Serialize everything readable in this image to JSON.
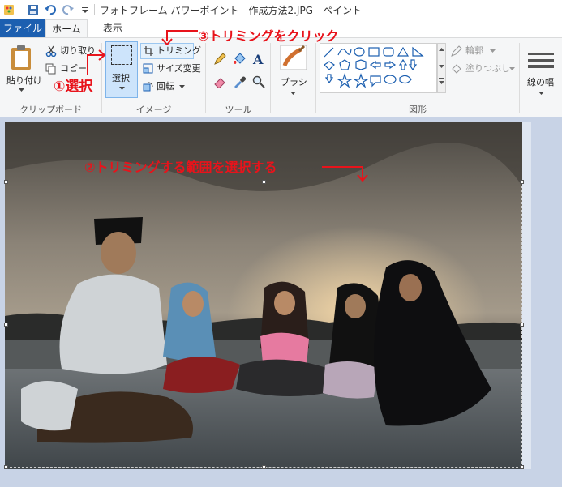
{
  "window": {
    "title": "フォトフレーム パワーポイント　作成方法2.JPG - ペイント"
  },
  "tabs": {
    "file": "ファイル",
    "home": "ホーム",
    "view": "表示"
  },
  "clipboard": {
    "paste": "貼り付け",
    "cut": "切り取り",
    "copy": "コピー",
    "group_label": "クリップボード"
  },
  "image_group": {
    "select": "選択",
    "crop": "トリミング",
    "resize": "サイズ変更",
    "rotate": "回転",
    "group_label": "イメージ"
  },
  "tools": {
    "group_label": "ツール"
  },
  "brushes": {
    "label": "ブラシ"
  },
  "shapes": {
    "outline": "輪郭",
    "fill": "塗りつぶし",
    "group_label": "図形"
  },
  "size": {
    "label": "線の幅"
  },
  "annotations": {
    "step1": "①選択",
    "step2": "②トリミングする範囲を選択する",
    "step3": "③トリミングをクリック"
  },
  "colors": {
    "accent": "#1c5fb0",
    "annotation": "#e8131b",
    "select_highlight": "#cde4fb"
  }
}
